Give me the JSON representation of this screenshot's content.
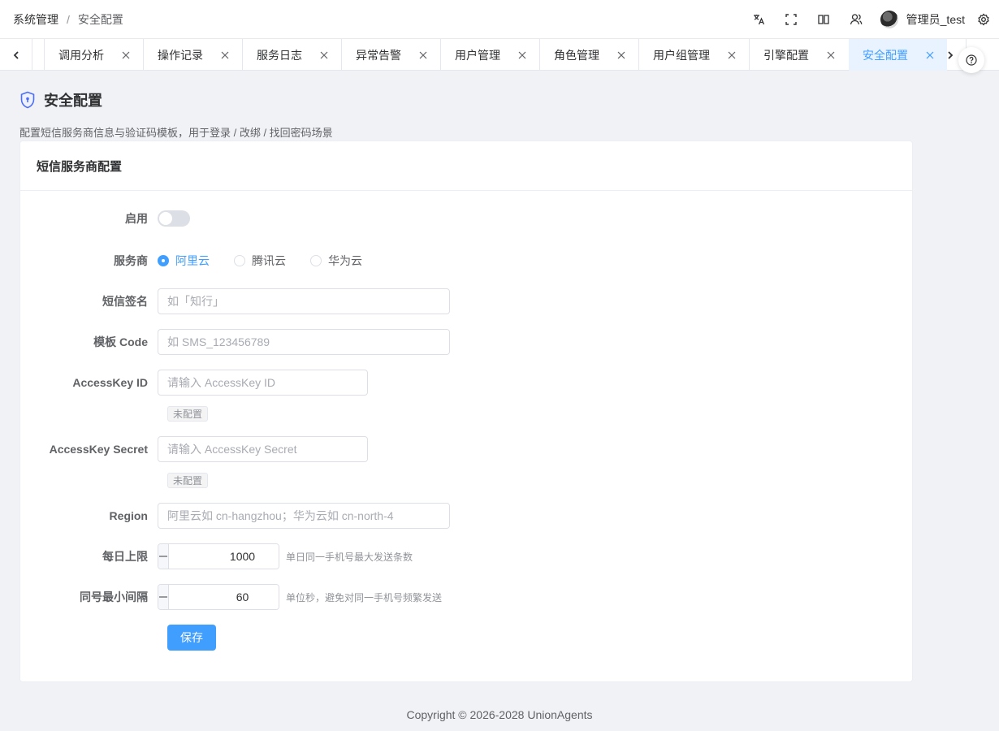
{
  "breadcrumb": {
    "parent": "系统管理",
    "separator": "/",
    "current": "安全配置"
  },
  "header": {
    "icons": [
      "translate-icon",
      "fullscreen-icon",
      "book-icon",
      "users-icon"
    ],
    "username": "管理员_test"
  },
  "tabs": [
    {
      "label": "调用分析",
      "active": false
    },
    {
      "label": "操作记录",
      "active": false
    },
    {
      "label": "服务日志",
      "active": false
    },
    {
      "label": "异常告警",
      "active": false
    },
    {
      "label": "用户管理",
      "active": false
    },
    {
      "label": "角色管理",
      "active": false
    },
    {
      "label": "用户组管理",
      "active": false
    },
    {
      "label": "引擎配置",
      "active": false
    },
    {
      "label": "安全配置",
      "active": true
    }
  ],
  "page": {
    "title": "安全配置",
    "description": "配置短信服务商信息与验证码模板，用于登录 / 改绑 / 找回密码场景"
  },
  "card": {
    "title": "短信服务商配置",
    "enable_label": "启用",
    "enabled": false,
    "provider_label": "服务商",
    "providers": [
      {
        "label": "阿里云",
        "checked": true
      },
      {
        "label": "腾讯云",
        "checked": false
      },
      {
        "label": "华为云",
        "checked": false
      }
    ],
    "signature": {
      "label": "短信签名",
      "placeholder": "如「知行」",
      "value": ""
    },
    "template": {
      "label": "模板 Code",
      "placeholder": "如 SMS_123456789",
      "value": ""
    },
    "access_key_id": {
      "label": "AccessKey ID",
      "placeholder": "请输入 AccessKey ID",
      "status": "未配置"
    },
    "access_key_secret": {
      "label": "AccessKey Secret",
      "placeholder": "请输入 AccessKey Secret",
      "status": "未配置"
    },
    "region": {
      "label": "Region",
      "placeholder": "阿里云如 cn-hangzhou；华为云如 cn-north-4"
    },
    "daily_limit": {
      "label": "每日上限",
      "value": "1000",
      "hint": "单日同一手机号最大发送条数"
    },
    "min_interval": {
      "label": "同号最小间隔",
      "value": "60",
      "hint": "单位秒，避免对同一手机号频繁发送"
    },
    "save_label": "保存"
  },
  "footer": {
    "copyright": "Copyright © 2026-2028 UnionAgents"
  },
  "colors": {
    "accent": "#409eff",
    "text": "#303133",
    "muted": "#909399",
    "bg": "#f0f2f5"
  }
}
